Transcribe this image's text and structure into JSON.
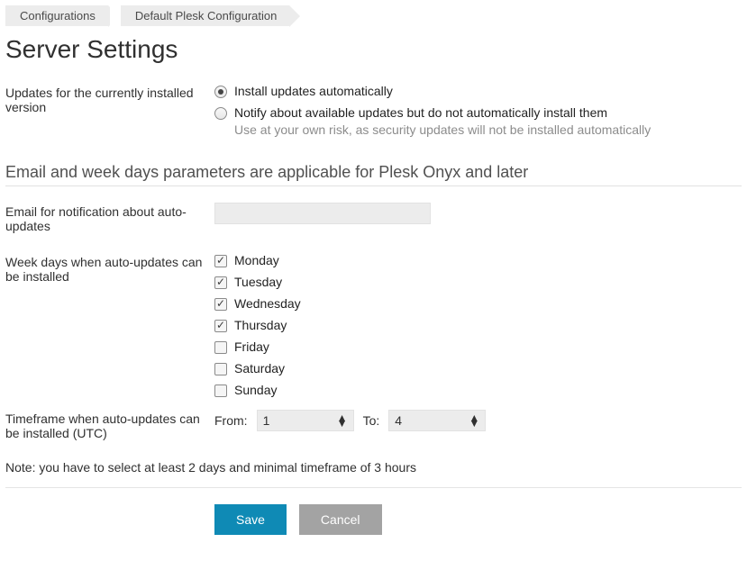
{
  "breadcrumb": {
    "items": [
      {
        "label": "Configurations"
      },
      {
        "label": "Default Plesk Configuration"
      }
    ]
  },
  "page": {
    "title": "Server Settings"
  },
  "updates": {
    "label": "Updates for the currently installed version",
    "options": {
      "auto": {
        "label": "Install updates automatically",
        "selected": true
      },
      "notify": {
        "label": "Notify about available updates but do not automatically install them",
        "hint": "Use at your own risk, as security updates will not be installed automatically",
        "selected": false
      }
    }
  },
  "section": {
    "heading": "Email and week days parameters are applicable for Plesk Onyx and later"
  },
  "email": {
    "label": "Email for notification about auto-updates",
    "value": ""
  },
  "weekdays": {
    "label": "Week days when auto-updates can be installed",
    "days": [
      {
        "label": "Monday",
        "checked": true
      },
      {
        "label": "Tuesday",
        "checked": true
      },
      {
        "label": "Wednesday",
        "checked": true
      },
      {
        "label": "Thursday",
        "checked": true
      },
      {
        "label": "Friday",
        "checked": false
      },
      {
        "label": "Saturday",
        "checked": false
      },
      {
        "label": "Sunday",
        "checked": false
      }
    ]
  },
  "timeframe": {
    "label": "Timeframe when auto-updates can be installed (UTC)",
    "from_label": "From:",
    "to_label": "To:",
    "from_value": "1",
    "to_value": "4"
  },
  "note": "Note: you have to select at least 2 days and minimal timeframe of 3 hours",
  "actions": {
    "save": "Save",
    "cancel": "Cancel"
  }
}
